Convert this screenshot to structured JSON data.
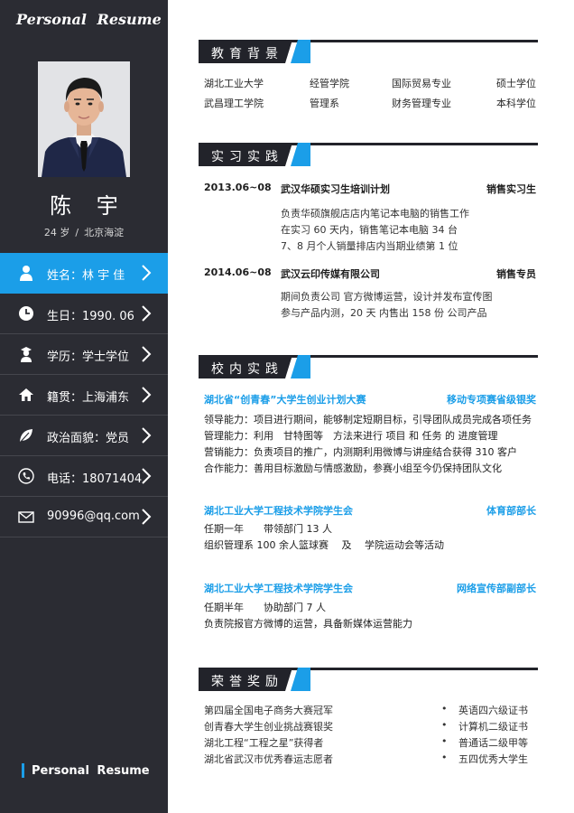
{
  "sidebar": {
    "title": "Personal  Resume",
    "name": "陈 宇",
    "age": "24 岁",
    "separator": "/",
    "location": "北京海淀",
    "items": [
      {
        "icon": "person-icon",
        "label": "姓名：林 宇 佳"
      },
      {
        "icon": "clock-icon",
        "label": "生日：1990. 06"
      },
      {
        "icon": "graduate-icon",
        "label": "学历：学士学位"
      },
      {
        "icon": "home-icon",
        "label": "籍贯：上海浦东"
      },
      {
        "icon": "leaf-icon",
        "label": "政治面貌：党员"
      },
      {
        "icon": "phone-icon",
        "label": "电话：18071404"
      },
      {
        "icon": "mail-icon",
        "label": "90996@qq.com"
      }
    ],
    "footer": "Personal  Resume"
  },
  "education": {
    "heading": "教育背景",
    "rows": [
      {
        "school": "湖北工业大学",
        "college": "经管学院",
        "major": "国际贸易专业",
        "degree": "硕士学位"
      },
      {
        "school": "武昌理工学院",
        "college": "管理系",
        "major": "财务管理专业",
        "degree": "本科学位"
      }
    ]
  },
  "internship": {
    "heading": "实习实践",
    "entries": [
      {
        "date": "2013.06~08",
        "company": "武汉华硕实习生培训计划",
        "role": "销售实习生",
        "lines": [
          "负责华硕旗舰店店内笔记本电脑的销售工作",
          "在实习 60 天内，销售笔记本电脑 34 台",
          "7、8 月个人销量排店内当期业绩第 1 位"
        ]
      },
      {
        "date": "2014.06~08",
        "company": "武汉云印传媒有限公司",
        "role": "销售专员",
        "lines": [
          "期间负责公司 官方微博运营，设计并发布宣传图",
          "参与产品内测，20 天 内售出 158 份 公司产品"
        ]
      }
    ]
  },
  "campus": {
    "heading": "校内实践",
    "entries": [
      {
        "title": "湖北省“创青春”大学生创业计划大赛",
        "role": "移动专项赛省级银奖",
        "lines": [
          "领导能力：项目进行期间，能够制定短期目标，引导团队成员完成各项任务",
          "管理能力：利用　甘特图等　方法来进行 项目 和 任务 的 进度管理",
          "营销能力：负责项目的推广，内测期利用微博与讲座结合获得 310 客户",
          "合作能力：善用目标激励与情感激励，参赛小组至今仍保持团队文化"
        ]
      },
      {
        "title": "湖北工业大学工程技术学院学生会",
        "role": "体育部部长",
        "lines": [
          "任期一年　　带领部门 13 人",
          "组织管理系 100 余人篮球赛　 及　 学院运动会等活动"
        ]
      },
      {
        "title": "湖北工业大学工程技术学院学生会",
        "role": "网络宣传部副部长",
        "lines": [
          "任期半年　　协助部门 7 人",
          "负责院报官方微博的运营，具备新媒体运营能力"
        ]
      }
    ]
  },
  "honors": {
    "heading": "荣誉奖励",
    "bullet": "•",
    "left": [
      "第四届全国电子商务大赛冠军",
      "创青春大学生创业挑战赛银奖",
      "湖北工程“工程之星”获得者",
      "湖北省武汉市优秀春运志愿者"
    ],
    "right": [
      "英语四六级证书",
      "计算机二级证书",
      "普通话二级甲等",
      "五四优秀大学生"
    ]
  },
  "colors": {
    "sidebar_bg": "#2b2c33",
    "accent": "#1b9ee8",
    "dark": "#22232a"
  }
}
